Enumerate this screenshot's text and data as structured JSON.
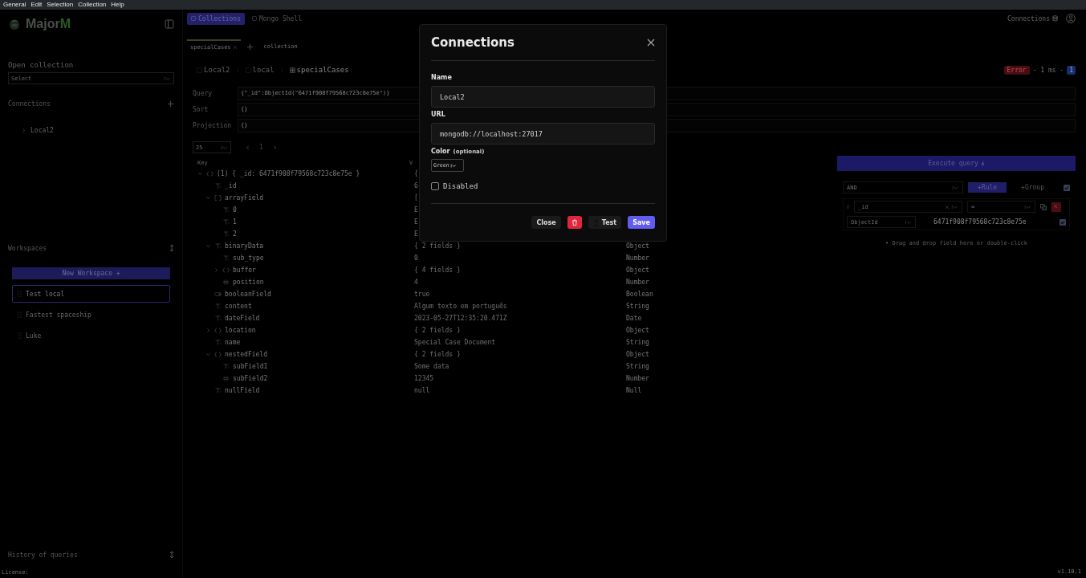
{
  "menu_bar": [
    "General",
    "Edit",
    "Selection",
    "Collection",
    "Help"
  ],
  "sidebar": {
    "app_name": "Major",
    "app_name_accent": "M",
    "open_collection": {
      "label": "Open collection",
      "placeholder": "Select"
    },
    "connections": {
      "label": "Connections",
      "items": [
        {
          "label": "Local2",
          "expanded": false
        }
      ]
    },
    "workspaces": {
      "label": "Workspaces",
      "new_button": "New Workspace +",
      "items": [
        {
          "label": "Test local",
          "selected": true
        },
        {
          "label": "Fastest spaceship",
          "selected": false
        },
        {
          "label": "Luke",
          "selected": false
        }
      ]
    },
    "history": {
      "label": "History of queries"
    },
    "license": {
      "label": "License:"
    }
  },
  "top_tabs": [
    {
      "label": "Collections",
      "selected": true
    },
    {
      "label": "Mongo Shell",
      "selected": false
    }
  ],
  "top_right": {
    "connections_label": "Connections"
  },
  "doc_tabs": [
    {
      "label": "specialCases",
      "selected": true
    }
  ],
  "new_tab_label": "collection",
  "breadcrumb": [
    "Local2",
    "local",
    "specialCases"
  ],
  "status": {
    "badge": "Error",
    "timing": "- 1 ms -",
    "count": "1"
  },
  "query_fields": [
    {
      "label": "Query",
      "value": "{\"_id\":ObjectId(\"6471f908f79568c723c8e75e\")}"
    },
    {
      "label": "Sort",
      "value": "{}"
    },
    {
      "label": "Projection",
      "value": "{}"
    }
  ],
  "pagination": {
    "page_size": "25",
    "page": "1"
  },
  "table": {
    "columns": [
      "Key",
      "V"
    ],
    "rows": [
      {
        "key": "(1) { _id: 6471f908f79568c723c8e75e }",
        "kind": "object",
        "value": "{",
        "expanded": true,
        "children": [
          {
            "key": "_id",
            "kind": "string",
            "value": "6"
          },
          {
            "key": "arrayField",
            "kind": "array",
            "value": "[",
            "expanded": true,
            "children": [
              {
                "key": "0",
                "kind": "string",
                "value": "E"
              },
              {
                "key": "1",
                "kind": "string",
                "value": "E"
              },
              {
                "key": "2",
                "kind": "string",
                "value": "E"
              }
            ]
          },
          {
            "key": "binaryData",
            "kind": "string",
            "value": "{ 2 fields }",
            "type": "Object",
            "expanded": true,
            "children": [
              {
                "key": "sub_type",
                "kind": "string",
                "value": "0",
                "type": "Number"
              },
              {
                "key": "buffer",
                "kind": "object",
                "value": "{ 4 fields }",
                "type": "Object",
                "expanded": false
              },
              {
                "key": "position",
                "kind": "number",
                "value": "4",
                "type": "Number"
              }
            ]
          },
          {
            "key": "booleanField",
            "kind": "boolean",
            "value": "true",
            "type": "Boolean"
          },
          {
            "key": "content",
            "kind": "string",
            "value": "Algum texto em português",
            "type": "String"
          },
          {
            "key": "dateField",
            "kind": "string",
            "value": "2023-05-27T12:35:20.471Z",
            "type": "Date"
          },
          {
            "key": "location",
            "kind": "object",
            "value": "{ 2 fields }",
            "type": "Object",
            "expanded": false
          },
          {
            "key": "name",
            "kind": "string",
            "value": "Special Case Document",
            "type": "String"
          },
          {
            "key": "nestedField",
            "kind": "object",
            "value": "{ 2 fields }",
            "type": "Object",
            "expanded": true,
            "children": [
              {
                "key": "subField1",
                "kind": "string",
                "value": "Some data",
                "type": "String"
              },
              {
                "key": "subField2",
                "kind": "number",
                "value": "12345",
                "type": "Number"
              }
            ]
          },
          {
            "key": "nullField",
            "kind": "string",
            "value": "null",
            "type": "Null"
          }
        ]
      }
    ]
  },
  "query_builder": {
    "execute_button": "Execute query",
    "combinator": "AND",
    "add_rule": "+Rule",
    "add_group": "+Group",
    "group_enabled": true,
    "rules": [
      {
        "field": "_id",
        "operator": "=",
        "value_type": "ObjectId",
        "value": "6471f908f79568c723c8e75e",
        "enabled": true
      }
    ],
    "hint": "• Drag and drop field here or double-click"
  },
  "version": "v1.10.1",
  "modal": {
    "title": "Connections",
    "fields": [
      {
        "label": "Name",
        "value": "Local2"
      },
      {
        "label": "URL",
        "value": "mongodb://localhost:27017"
      }
    ],
    "color": {
      "label": "Color",
      "hint": "(optional)",
      "value": "Green"
    },
    "disabled": {
      "label": "Disabled",
      "checked": false
    },
    "buttons": [
      {
        "kind": "close",
        "label": "Close"
      },
      {
        "kind": "delete"
      },
      {
        "kind": "test",
        "label": "Test"
      },
      {
        "kind": "save",
        "label": "Save"
      }
    ]
  }
}
